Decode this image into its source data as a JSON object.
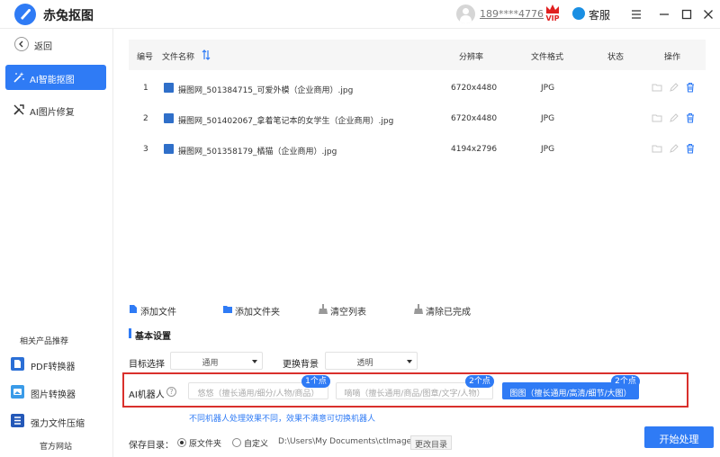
{
  "app": {
    "title": "赤兔抠图"
  },
  "header": {
    "user_phone": "189****4776",
    "vip_label": "VIP",
    "service_label": "客服"
  },
  "sidebar": {
    "back_label": "返回",
    "items": [
      {
        "label": "AI智能抠图",
        "active": true
      },
      {
        "label": "AI图片修复",
        "active": false
      }
    ],
    "recommend_title": "相关产品推荐",
    "recommend": [
      {
        "label": "PDF转换器"
      },
      {
        "label": "图片转换器"
      },
      {
        "label": "强力文件压缩"
      }
    ],
    "official_site": "官方网站"
  },
  "table": {
    "columns": {
      "index": "编号",
      "name": "文件名称",
      "resolution": "分辨率",
      "format": "文件格式",
      "status": "状态",
      "actions": "操作"
    },
    "rows": [
      {
        "index": "1",
        "name": "摄图网_501384715_可爱外模（企业商用）.jpg",
        "resolution": "6720x4480",
        "format": "JPG",
        "status": ""
      },
      {
        "index": "2",
        "name": "摄图网_501402067_拿着笔记本的女学生（企业商用）.jpg",
        "resolution": "6720x4480",
        "format": "JPG",
        "status": ""
      },
      {
        "index": "3",
        "name": "摄图网_501358179_橘猫（企业商用）.jpg",
        "resolution": "4194x2796",
        "format": "JPG",
        "status": ""
      }
    ]
  },
  "toolbar": {
    "add_file": "添加文件",
    "add_folder": "添加文件夹",
    "clear_list": "清空列表",
    "clear_done": "清除已完成"
  },
  "settings": {
    "section_title": "基本设置",
    "target_label": "目标选择",
    "target_value": "通用",
    "bg_label": "更换背景",
    "bg_value": "透明",
    "robot_label": "AI机器人",
    "robots": [
      {
        "label": "悠悠（擅长通用/细分/人物/商品）",
        "tag": "1个点",
        "selected": false
      },
      {
        "label": "嘀嘀（擅长通用/商品/图章/文字/人物）",
        "tag": "2个点",
        "selected": false
      },
      {
        "label": "图图（擅长通用/高清/细节/大图）",
        "tag": "2个点",
        "selected": true
      }
    ],
    "hint": "不同机器人处理效果不同，效果不满意可切换机器人",
    "save_label": "保存目录：",
    "save_options": [
      {
        "label": "原文件夹",
        "selected": true
      },
      {
        "label": "自定义",
        "selected": false
      }
    ],
    "save_path": "D:\\Users\\My Documents\\ctImageS",
    "change_dir": "更改目录",
    "start_button": "开始处理"
  },
  "colors": {
    "accent": "#2f7bf5",
    "highlight_border": "#d9302c",
    "vip": "#e02020"
  }
}
